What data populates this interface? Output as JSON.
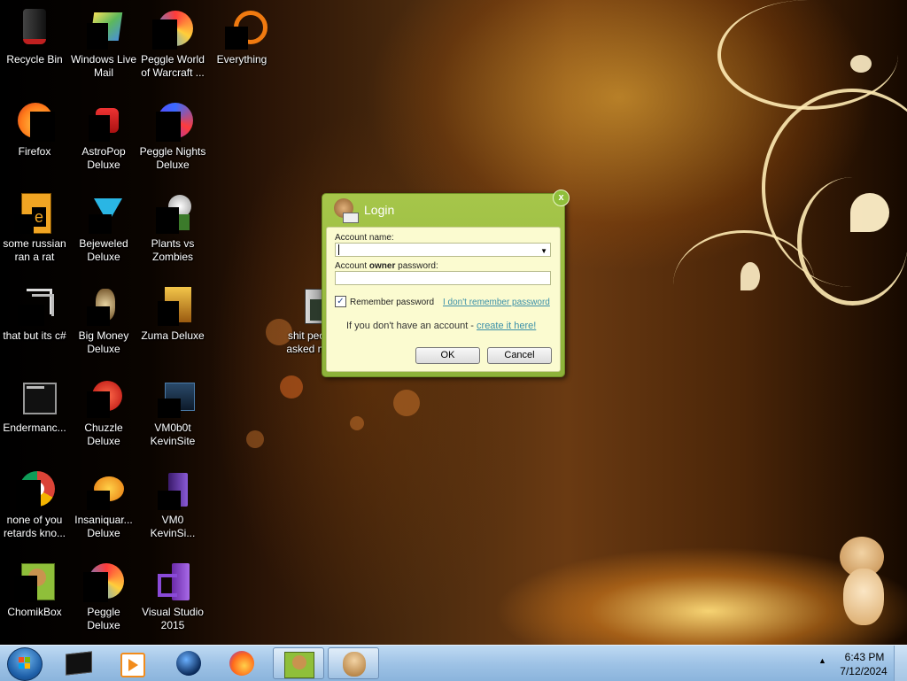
{
  "desktop_icons": [
    {
      "label": "Recycle Bin",
      "icon": "recycle-bin-icon"
    },
    {
      "label": "Windows Live Mail",
      "icon": "mail-icon"
    },
    {
      "label": "Peggle World of Warcraft ...",
      "icon": "peggle-icon"
    },
    {
      "label": "Everything",
      "icon": "search-icon"
    },
    {
      "label": "Firefox",
      "icon": "firefox-icon"
    },
    {
      "label": "AstroPop Deluxe",
      "icon": "game-icon"
    },
    {
      "label": "Peggle Nights Deluxe",
      "icon": "peggle-icon"
    },
    {
      "label": "some russian ran a rat",
      "icon": "file-icon"
    },
    {
      "label": "Bejeweled Deluxe",
      "icon": "gem-icon"
    },
    {
      "label": "Plants vs Zombies",
      "icon": "plant-icon"
    },
    {
      "label": "that but its c#",
      "icon": "shortcut-icon"
    },
    {
      "label": "Big Money Deluxe",
      "icon": "game-icon"
    },
    {
      "label": "Zuma Deluxe",
      "icon": "game-icon"
    },
    {
      "label": "shit peo... asked m...",
      "icon": "folder-icon"
    },
    {
      "label": "Endermanc...",
      "icon": "window-icon"
    },
    {
      "label": "Chuzzle Deluxe",
      "icon": "game-icon"
    },
    {
      "label": "VM0b0t KevinSite",
      "icon": "folder-icon"
    },
    {
      "label": "none of you retards kno...",
      "icon": "chrome-icon"
    },
    {
      "label": "Insaniquar... Deluxe",
      "icon": "fish-icon"
    },
    {
      "label": "VM0 KevinSi...",
      "icon": "visual-studio-icon"
    },
    {
      "label": "ChomikBox",
      "icon": "hamster-icon"
    },
    {
      "label": "Peggle Deluxe",
      "icon": "peggle-icon"
    },
    {
      "label": "Visual Studio 2015",
      "icon": "visual-studio-icon"
    }
  ],
  "dialog": {
    "title": "Login",
    "account_name_label": "Account name:",
    "account_name_value": "",
    "password_label_prefix": "Account ",
    "password_label_bold": "owner",
    "password_label_suffix": " password:",
    "password_value": "",
    "remember_label": "Remember password",
    "remember_checked": true,
    "forgot_link": "I don't remember password",
    "no_account_text": "If you don't have an account - ",
    "create_link": "create it here!",
    "ok_label": "OK",
    "cancel_label": "Cancel",
    "close_glyph": "x"
  },
  "taskbar": {
    "clock_time": "6:43 PM",
    "clock_date": "7/12/2024",
    "items": [
      {
        "icon": "terminal-icon",
        "open": false
      },
      {
        "icon": "media-player-icon",
        "open": false
      },
      {
        "icon": "globe-icon",
        "open": false
      },
      {
        "icon": "firefox-icon",
        "open": false
      },
      {
        "icon": "chomikbox-icon",
        "open": true
      },
      {
        "icon": "hamster-icon",
        "open": true
      }
    ],
    "tray_arrow": "▲"
  },
  "colors": {
    "dialog_frame": "#8db23a",
    "dialog_body": "#fbfbd0",
    "link": "#3a8fa8",
    "taskbar": "#9fc3e6"
  }
}
